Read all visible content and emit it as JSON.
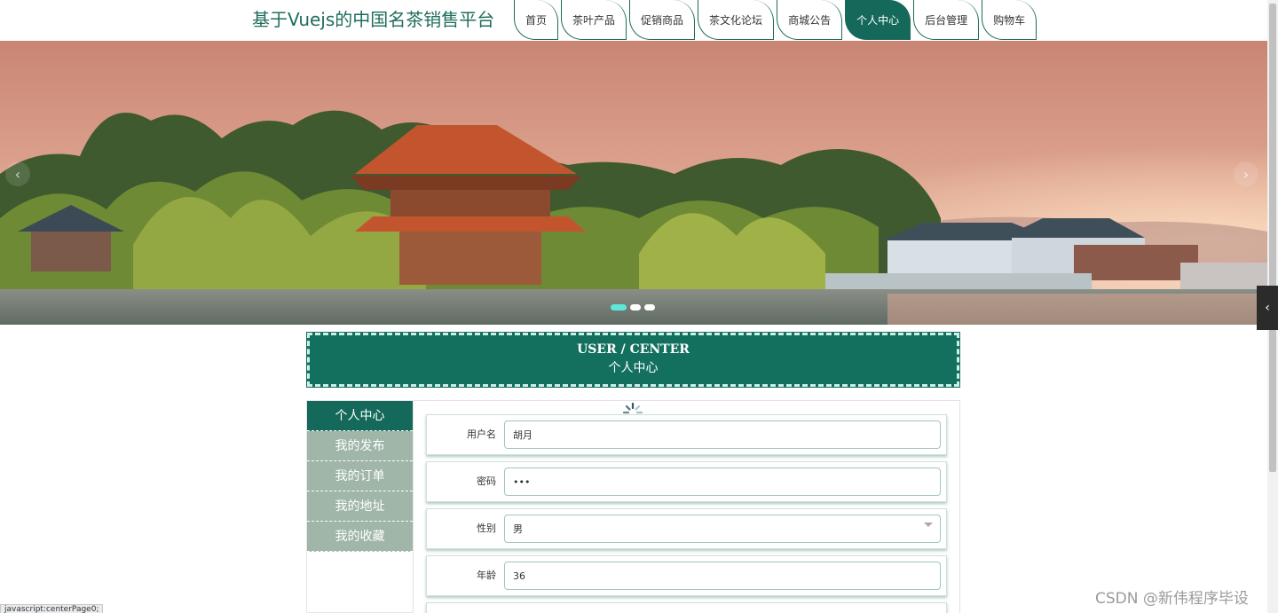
{
  "header": {
    "site_title": "基于Vuejs的中国名茶销售平台",
    "nav": [
      {
        "label": "首页",
        "active": false
      },
      {
        "label": "茶叶产品",
        "active": false
      },
      {
        "label": "促销商品",
        "active": false
      },
      {
        "label": "茶文化论坛",
        "active": false
      },
      {
        "label": "商城公告",
        "active": false
      },
      {
        "label": "个人中心",
        "active": true
      },
      {
        "label": "后台管理",
        "active": false
      },
      {
        "label": "购物车",
        "active": false
      }
    ]
  },
  "banner": {
    "prev_icon": "‹",
    "next_icon": "›",
    "slide_count": 3,
    "active_slide": 0
  },
  "user_center": {
    "title_en": "USER / CENTER",
    "title_cn": "个人中心"
  },
  "side_menu": {
    "items": [
      {
        "label": "个人中心",
        "active": true
      },
      {
        "label": "我的发布",
        "active": false
      },
      {
        "label": "我的订单",
        "active": false
      },
      {
        "label": "我的地址",
        "active": false
      },
      {
        "label": "我的收藏",
        "active": false
      }
    ]
  },
  "form": {
    "username": {
      "label": "用户名",
      "value": "胡月"
    },
    "password": {
      "label": "密码",
      "value": "•••"
    },
    "gender": {
      "label": "性别",
      "value": "男"
    },
    "age": {
      "label": "年龄",
      "value": "36"
    }
  },
  "sidebar_toggle_icon": "‹",
  "watermark": "CSDN @新伟程序毕设",
  "status_url": "javascript:centerPage0;",
  "colors": {
    "primary": "#15695a",
    "menu_inactive": "#9fb6a9",
    "dot_active": "#5ee8d9"
  }
}
